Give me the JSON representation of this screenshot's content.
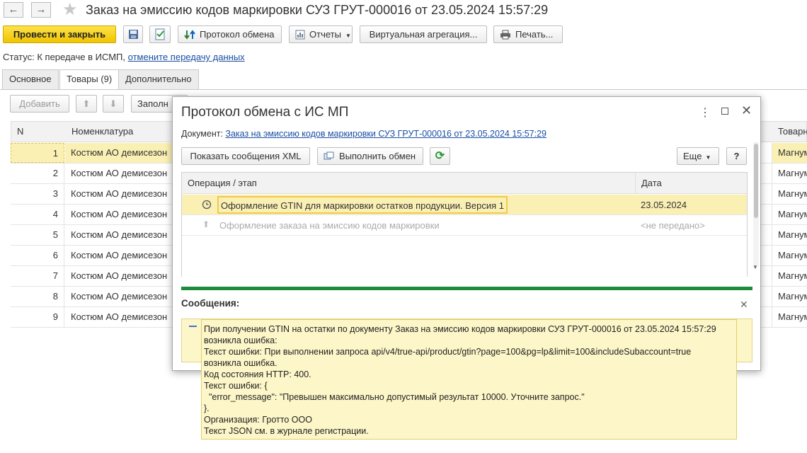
{
  "window": {
    "title": "Заказ на эмиссию кодов маркировки СУЗ ГРУТ-000016 от 23.05.2024 15:57:29"
  },
  "toolbar": {
    "post_close": "Провести и закрыть",
    "protocol": "Протокол обмена",
    "reports": "Отчеты",
    "virtual_aggregation": "Виртуальная агрегация...",
    "print": "Печать..."
  },
  "status": {
    "label": "Статус:",
    "text": "К передаче в ИСМП,",
    "link": "отмените передачу данных"
  },
  "tabs": [
    {
      "label": "Основное"
    },
    {
      "label": "Товары (9)"
    },
    {
      "label": "Дополнительно"
    }
  ],
  "goods_toolbar": {
    "add": "Добавить",
    "fill": "Заполн"
  },
  "grid": {
    "headers": {
      "n": "N",
      "nomenclature": "Номенклатура",
      "brand": "Товарн"
    },
    "rows": [
      {
        "n": "1",
        "name": "Костюм АО демисезон",
        "brand": "Магнум"
      },
      {
        "n": "2",
        "name": "Костюм АО демисезон",
        "brand": "Магнум"
      },
      {
        "n": "3",
        "name": "Костюм АО демисезон",
        "brand": "Магнум"
      },
      {
        "n": "4",
        "name": "Костюм АО демисезон",
        "brand": "Магнум"
      },
      {
        "n": "5",
        "name": "Костюм АО демисезон",
        "brand": "Магнум"
      },
      {
        "n": "6",
        "name": "Костюм АО демисезон",
        "brand": "Магнум"
      },
      {
        "n": "7",
        "name": "Костюм АО демисезон",
        "brand": "Магнум"
      },
      {
        "n": "8",
        "name": "Костюм АО демисезон",
        "brand": "Магнум"
      },
      {
        "n": "9",
        "name": "Костюм АО демисезон",
        "brand": "Магнум"
      }
    ]
  },
  "dialog": {
    "title": "Протокол обмена с ИС МП",
    "doc_label": "Документ:",
    "doc_link": "Заказ на эмиссию кодов маркировки СУЗ ГРУТ-000016 от 23.05.2024 15:57:29",
    "show_xml": "Показать сообщения XML",
    "exchange": "Выполнить обмен",
    "more": "Еще",
    "help": "?",
    "table": {
      "headers": {
        "operation": "Операция / этап",
        "date": "Дата"
      },
      "rows": [
        {
          "operation": "Оформление GTIN для маркировки остатков продукции. Версия 1",
          "date": "23.05.2024"
        },
        {
          "operation": "Оформление заказа на эмиссию кодов маркировки",
          "date": "<не передано>"
        }
      ]
    },
    "messages_title": "Сообщения:",
    "message": "При получении GTIN на остатки по документу Заказ на эмиссию кодов маркировки СУЗ ГРУТ-000016 от 23.05.2024 15:57:29\nвозникла ошибка:\nТекст ошибки: При выполнении запроса api/v4/true-api/product/gtin?page=100&pg=lp&limit=100&includeSubaccount=true\nвозникла ошибка.\nКод состояния HTTP: 400.\nТекст ошибки: {\n  \"error_message\": \"Превышен максимально допустимый результат 10000. Уточните запрос.\"\n}.\nОрганизация: Гротто ООО\nТекст JSON см. в журнале регистрации."
  },
  "colors": {
    "accent_yellow": "#f5cf1b",
    "selection": "#fbf0b4",
    "link": "#1a4fa3",
    "success_bar": "#1e8a3c"
  }
}
